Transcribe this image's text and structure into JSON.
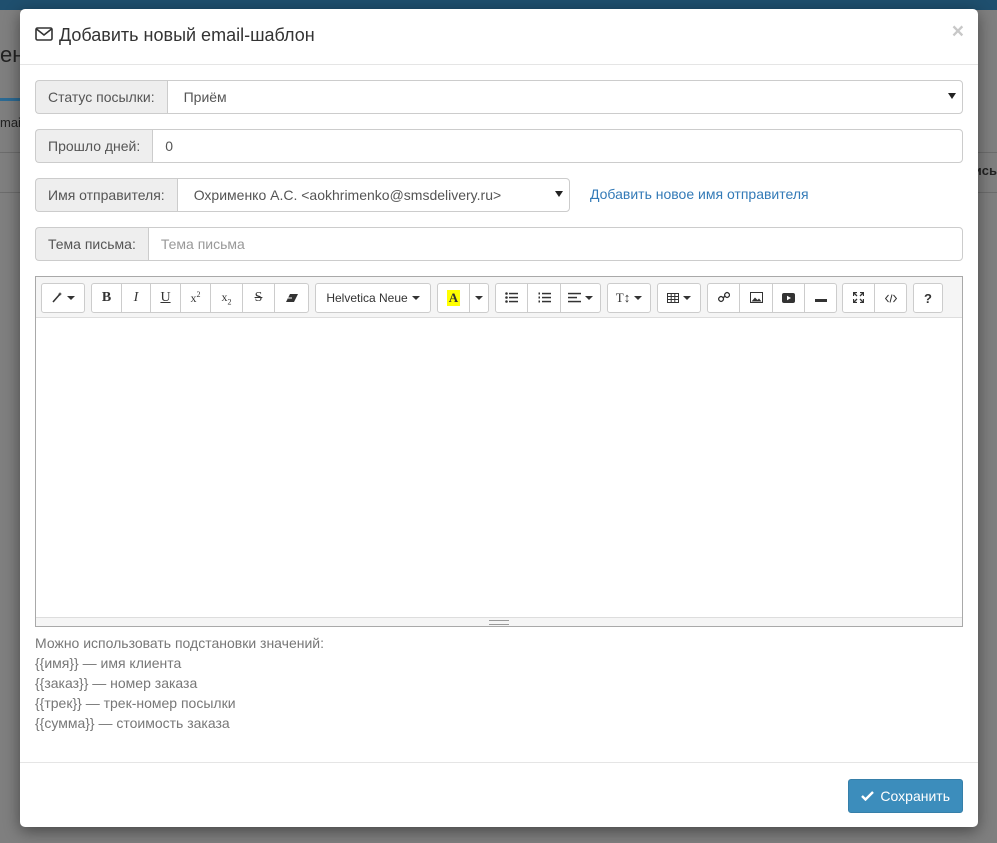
{
  "background": {
    "title_fragment": "ені",
    "left_fragment": "mai",
    "right_fragment": "ись"
  },
  "modal": {
    "title": "Добавить новый email-шаблон",
    "close": "×",
    "fields": {
      "status_label": "Статус посылки:",
      "status_value": "Приём",
      "days_label": "Прошло дней:",
      "days_value": "0",
      "sender_label": "Имя отправителя:",
      "sender_value": "Охрименко А.С. <aokhrimenko@smsdelivery.ru>",
      "add_sender_link": "Добавить новое имя отправителя",
      "subject_label": "Тема письма:",
      "subject_placeholder": "Тема письма"
    },
    "toolbar": {
      "font_name": "Helvetica Neue",
      "bold": "B",
      "italic": "I",
      "underline": "U",
      "color_letter": "A",
      "help": "?"
    },
    "hints": {
      "intro": "Можно использовать подстановки значений:",
      "name": "{{имя}} — имя клиента",
      "order": "{{заказ}} — номер заказа",
      "track": "{{трек}} — трек-номер посылки",
      "sum": "{{сумма}} — стоимость заказа"
    },
    "footer": {
      "save": "Сохранить"
    }
  },
  "colors": {
    "primary": "#3c8dbc",
    "link": "#337ab7",
    "highlight": "#ffff00"
  }
}
